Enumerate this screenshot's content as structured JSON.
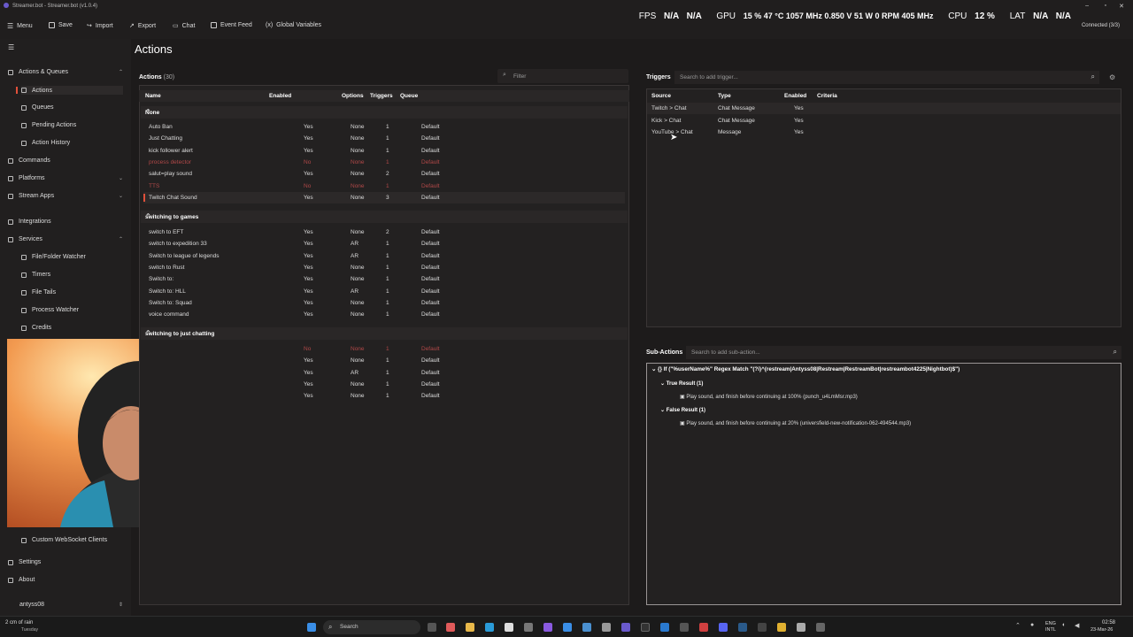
{
  "window": {
    "title": "Streamer.bot - Streamer.bot (v1.0.4)"
  },
  "toolbar": {
    "menu": "Menu",
    "save": "Save",
    "import": "Import",
    "export": "Export",
    "chat": "Chat",
    "event_feed": "Event Feed",
    "global_variables": "Global Variables"
  },
  "hud": {
    "fps_label": "FPS",
    "fps_1": "N/A",
    "fps_2": "N/A",
    "gpu_label": "GPU",
    "gpu_vals": "15 % 47 °C 1057 MHz 0.850 V 51 W 0 RPM 405 MHz",
    "cpu_label": "CPU",
    "cpu_val": "12 %",
    "lat_label": "LAT",
    "lat_1": "N/A",
    "lat_2": "N/A",
    "connected": "Connected (3/3)"
  },
  "sidebar": {
    "actions_queues": "Actions & Queues",
    "actions": "Actions",
    "queues": "Queues",
    "pending": "Pending Actions",
    "history": "Action History",
    "commands": "Commands",
    "platforms": "Platforms",
    "stream_apps": "Stream Apps",
    "integrations": "Integrations",
    "services": "Services",
    "file_watcher": "File/Folder Watcher",
    "timers": "Timers",
    "file_tails": "File Tails",
    "process_watcher": "Process Watcher",
    "credits": "Credits",
    "ws_clients": "Custom WebSocket Clients",
    "settings": "Settings",
    "about": "About",
    "user": "antyss08"
  },
  "page": {
    "title": "Actions"
  },
  "actions": {
    "label": "Actions",
    "count": "(30)",
    "filter_placeholder": "Filter",
    "columns": {
      "name": "Name",
      "enabled": "Enabled",
      "options": "Options",
      "triggers": "Triggers",
      "queue": "Queue"
    },
    "groups": [
      {
        "name": "None",
        "rows": [
          [
            "Auto Ban",
            "Yes",
            "None",
            "1",
            "Default"
          ],
          [
            "Just Chatting",
            "Yes",
            "None",
            "1",
            "Default"
          ],
          [
            "kick follower alert",
            "Yes",
            "None",
            "1",
            "Default"
          ],
          [
            "process detector",
            "No",
            "None",
            "1",
            "Default"
          ],
          [
            "salut=play sound",
            "Yes",
            "None",
            "2",
            "Default"
          ],
          [
            "TTS",
            "No",
            "None",
            "1",
            "Default"
          ],
          [
            "Twitch Chat Sound",
            "Yes",
            "None",
            "3",
            "Default"
          ]
        ]
      },
      {
        "name": "switching to games",
        "rows": [
          [
            "switch to EFT",
            "Yes",
            "None",
            "2",
            "Default"
          ],
          [
            "switch to expedition 33",
            "Yes",
            "AR",
            "1",
            "Default"
          ],
          [
            "Switch to league of legends",
            "Yes",
            "AR",
            "1",
            "Default"
          ],
          [
            "switch to Rust",
            "Yes",
            "None",
            "1",
            "Default"
          ],
          [
            "Switch to:",
            "Yes",
            "None",
            "1",
            "Default"
          ],
          [
            "Switch to: HLL",
            "Yes",
            "AR",
            "1",
            "Default"
          ],
          [
            "Switch to: Squad",
            "Yes",
            "None",
            "1",
            "Default"
          ],
          [
            "voice command",
            "Yes",
            "None",
            "1",
            "Default"
          ]
        ]
      },
      {
        "name": "switching to just chatting",
        "rows": [
          [
            "",
            "No",
            "None",
            "1",
            "Default"
          ],
          [
            "",
            "Yes",
            "None",
            "1",
            "Default"
          ],
          [
            "",
            "Yes",
            "AR",
            "1",
            "Default"
          ],
          [
            "",
            "Yes",
            "None",
            "1",
            "Default"
          ],
          [
            "",
            "Yes",
            "None",
            "1",
            "Default"
          ]
        ]
      }
    ]
  },
  "triggers": {
    "label": "Triggers",
    "search_placeholder": "Search to add trigger...",
    "columns": {
      "source": "Source",
      "type": "Type",
      "enabled": "Enabled",
      "criteria": "Criteria"
    },
    "rows": [
      [
        "Twitch > Chat",
        "Chat Message",
        "Yes",
        ""
      ],
      [
        "Kick > Chat",
        "Chat Message",
        "Yes",
        ""
      ],
      [
        "YouTube > Chat",
        "Message",
        "Yes",
        ""
      ]
    ]
  },
  "subactions": {
    "label": "Sub-Actions",
    "search_placeholder": "Search to add sub-action...",
    "if_line": "If (\"%userName%\" Regex Match \"(?i)^(restream|Antyss08|Restream|RestreamBot|restreambot4225|Nightbot)$\")",
    "true_label": "True Result (1)",
    "true_item": "Play sound, and finish before continuing at 100% (punch_u4LmMsr.mp3)",
    "false_label": "False Result (1)",
    "false_item": "Play sound, and finish before continuing at 20% (universfield-new-notification-062-494544.mp3)"
  },
  "taskbar": {
    "weather": "2 cm of rain",
    "day": "Tuesday",
    "search": "Search",
    "lang": "ENG",
    "lang2": "INTL",
    "time": "02:58",
    "date": "23-Mar-26"
  },
  "colors": {
    "accent": "#e0503a",
    "disabled": "#b04848"
  }
}
